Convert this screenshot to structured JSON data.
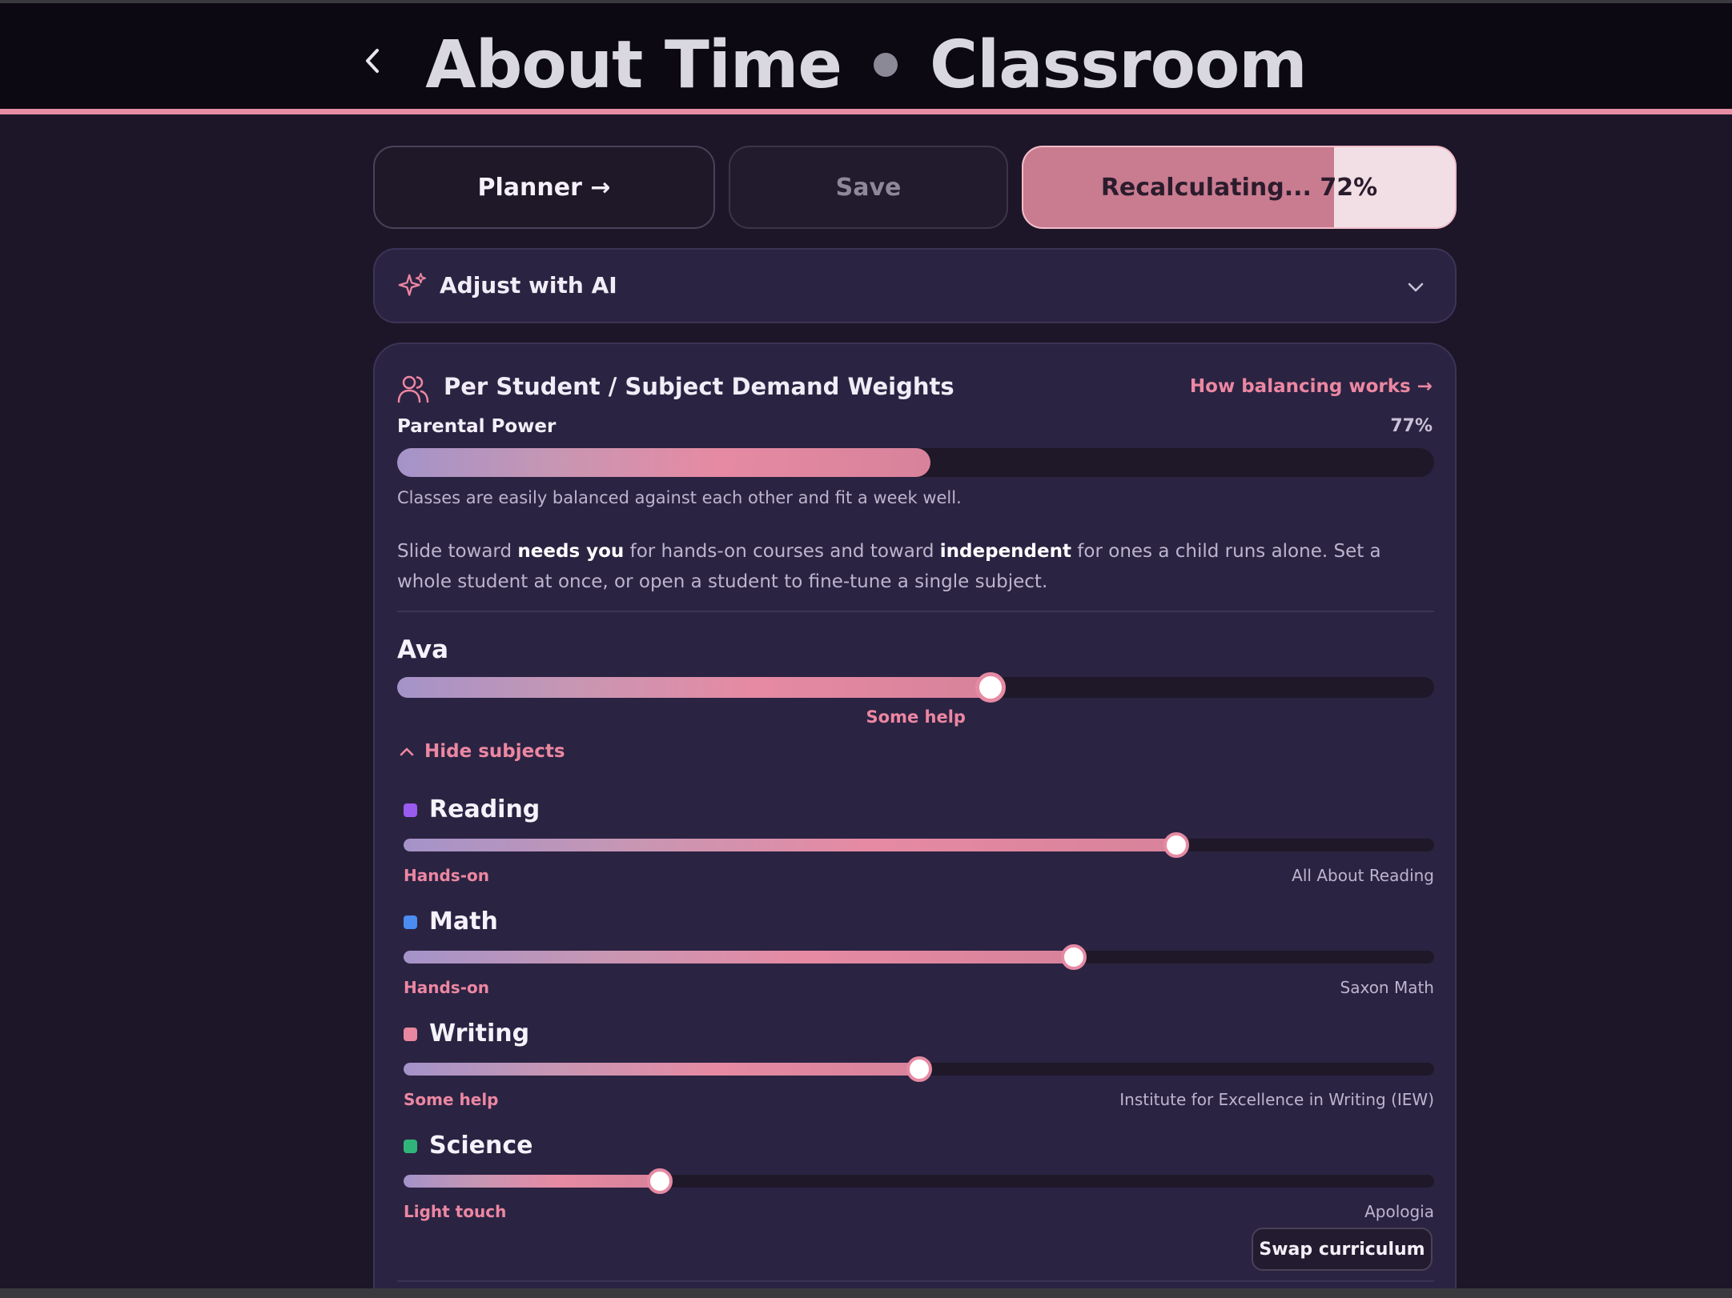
{
  "header": {
    "title_left": "About Time",
    "title_right": "Classroom"
  },
  "toolbar": {
    "planner_label": "Planner →",
    "save_label": "Save",
    "recalc_label": "Recalculating... 72%",
    "recalc_progress": 0.72
  },
  "ai": {
    "label": "Adjust with AI"
  },
  "card": {
    "title": "Per Student / Subject Demand Weights",
    "link": "How balancing works →",
    "parental_power_label": "Parental Power",
    "parental_power_value": "77%",
    "parental_power_fill": 0.514,
    "parental_power_desc": "Classes are easily balanced against each other and fit a week well.",
    "intro_a": "Slide toward ",
    "intro_b": "needs you",
    "intro_c": " for hands-on courses and toward ",
    "intro_d": "independent",
    "intro_e": " for ones a child runs alone. Set a whole student at once, or open a student to fine-tune a single subject."
  },
  "student": {
    "name": "Ava",
    "level": "Some help",
    "slider": 0.572,
    "toggle_label": "Hide subjects",
    "swap_label": "Swap curriculum",
    "subjects": [
      {
        "name": "Reading",
        "color": "#9a5cf0",
        "slider": 0.75,
        "level": "Hands-on",
        "curriculum": "All About Reading"
      },
      {
        "name": "Math",
        "color": "#4a8cf0",
        "slider": 0.65,
        "level": "Hands-on",
        "curriculum": "Saxon Math"
      },
      {
        "name": "Writing",
        "color": "#e8879f",
        "slider": 0.5,
        "level": "Some help",
        "curriculum": "Institute for Excellence in Writing (IEW)"
      },
      {
        "name": "Science",
        "color": "#2fb57a",
        "slider": 0.249,
        "level": "Light touch",
        "curriculum": "Apologia"
      }
    ]
  },
  "icons": {
    "back": "chevron-left-icon",
    "ai": "sparkle-icon",
    "expand": "chevron-down-icon",
    "users": "users-icon",
    "collapse": "chevron-up-icon"
  }
}
